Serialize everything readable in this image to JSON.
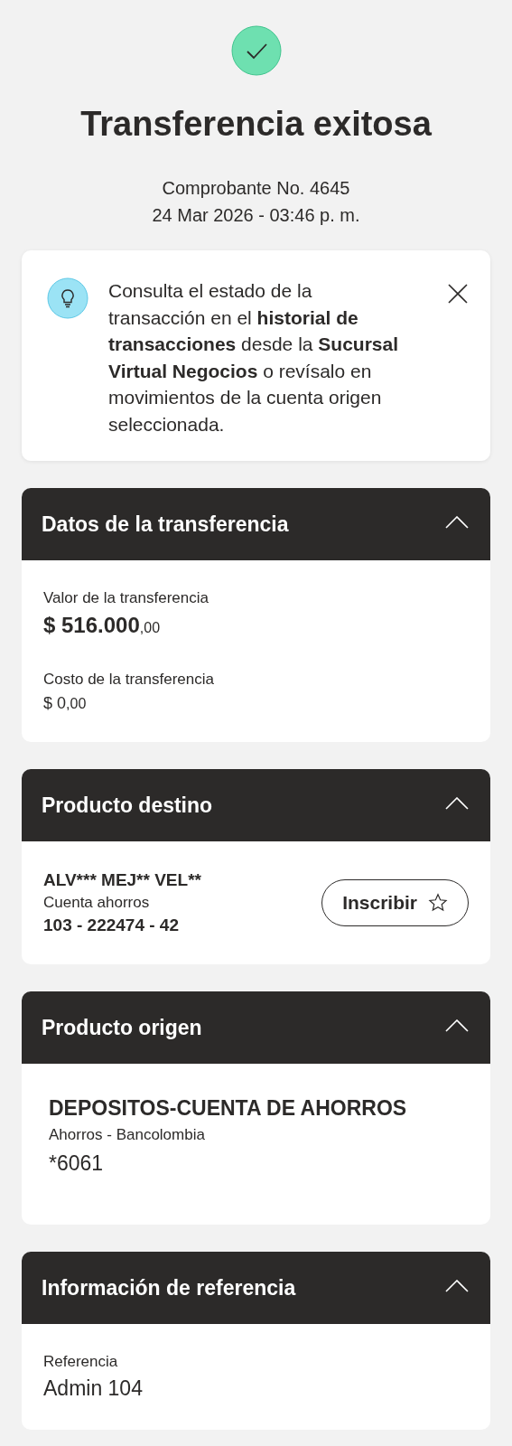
{
  "status": {
    "title": "Transferencia exitosa",
    "receipt": "Comprobante No. 4645",
    "datetime": "24 Mar 2026 - 03:46 p. m."
  },
  "notice": {
    "text": "Consulta el estado de la transacción en el **historial de transacciones** desde la **Sucursal Virtual Negocios** o revísalo en movimientos de la cuenta origen seleccionada."
  },
  "sections": [
    {
      "title": "Datos de la transferencia",
      "expanded": true,
      "kind": "fields",
      "fields": [
        {
          "label": "Valor de la transferencia",
          "value": "$ 516.000",
          "cents": ",00",
          "kind": "amount-large"
        },
        {
          "label": "Costo de la transferencia",
          "value": "$ 0",
          "cents": ",00",
          "kind": "amount-small"
        }
      ]
    },
    {
      "title": "Producto destino",
      "expanded": true,
      "kind": "payee",
      "name": "ALV*** MEJ** VEL**",
      "type": "Cuenta ahorros",
      "number": "103 - 222474 - 42",
      "button": "Inscribir"
    },
    {
      "title": "Producto origen",
      "expanded": true,
      "kind": "product",
      "name": "DEPOSITOS-CUENTA DE AHORROS",
      "type": "Ahorros - Bancolombia",
      "number": "*6061"
    },
    {
      "title": "Información de referencia",
      "expanded": true,
      "kind": "fields",
      "fields": [
        {
          "label": "Referencia",
          "value": "Admin 104",
          "kind": "text-large"
        }
      ]
    }
  ]
}
